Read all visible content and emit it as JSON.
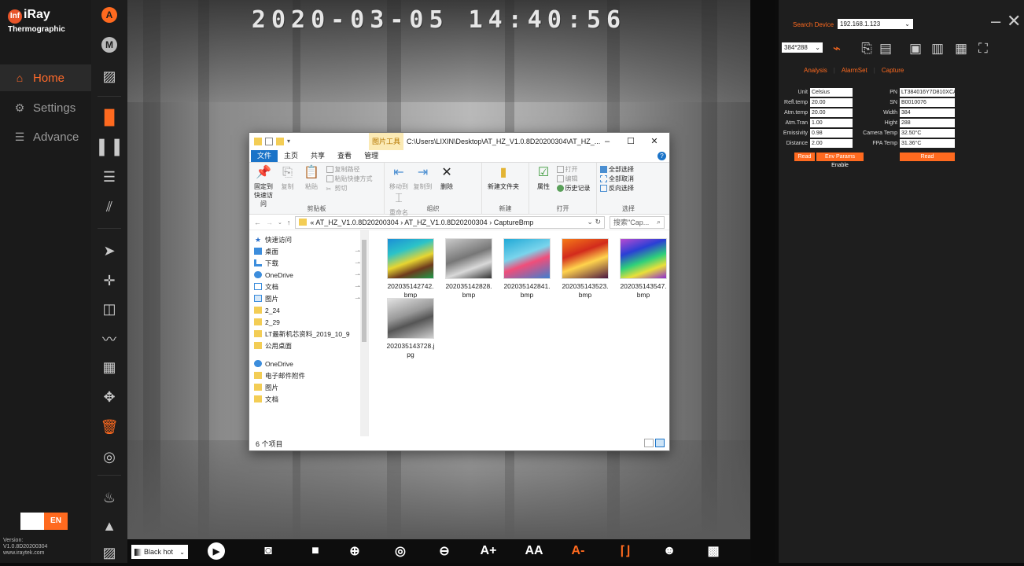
{
  "app": {
    "brand": "iRay",
    "brand_badge": "Inf",
    "subtitle": "Thermographic",
    "version_label": "Version:",
    "version": "V1.0.8D20200304",
    "website": "www.iraytek.com",
    "lang": "EN"
  },
  "nav": [
    {
      "label": "Home",
      "icon": "home-icon"
    },
    {
      "label": "Settings",
      "icon": "gear-icon"
    },
    {
      "label": "Advance",
      "icon": "sliders-icon"
    }
  ],
  "toolstrip": {
    "a_label": "A",
    "m_label": "M"
  },
  "timestamp": "2020-03-05 14:40:56",
  "bottombar": {
    "palette": "Black hot",
    "a_plus": "A+",
    "a_auto": "AA",
    "a_minus": "A-"
  },
  "explorer": {
    "picture_tools": "图片工具",
    "path": "C:\\Users\\LIXIN\\Desktop\\AT_HZ_V1.0.8D20200304\\AT_HZ_...",
    "tabs": [
      "文件",
      "主页",
      "共享",
      "查看",
      "管理"
    ],
    "ribbon": {
      "pin": "固定到快速访问",
      "copy": "复制",
      "paste": "粘贴",
      "copy_path": "复制路径",
      "paste_shortcut": "粘贴快捷方式",
      "cut": "剪切",
      "group_clipboard": "剪贴板",
      "move_to": "移动到",
      "copy_to": "复制到",
      "delete": "删除",
      "rename": "重命名",
      "group_organize": "组织",
      "new_folder": "新建文件夹",
      "group_new": "新建",
      "properties": "属性",
      "open": "打开",
      "edit": "编辑",
      "history": "历史记录",
      "group_open": "打开",
      "select_all": "全部选择",
      "select_none": "全部取消",
      "invert": "反向选择",
      "group_select": "选择"
    },
    "address": "« AT_HZ_V1.0.8D20200304 › AT_HZ_V1.0.8D20200304 › CaptureBmp",
    "search_placeholder": "搜索\"Cap...",
    "sidebar": [
      {
        "label": "快速访问",
        "type": "star",
        "pin": false
      },
      {
        "label": "桌面",
        "type": "desk",
        "pin": true
      },
      {
        "label": "下载",
        "type": "down",
        "pin": true
      },
      {
        "label": "OneDrive",
        "type": "cloud",
        "pin": true
      },
      {
        "label": "文档",
        "type": "doc",
        "pin": true
      },
      {
        "label": "图片",
        "type": "pic",
        "pin": true
      },
      {
        "label": "2_24",
        "type": "folder",
        "pin": false
      },
      {
        "label": "2_29",
        "type": "folder",
        "pin": false
      },
      {
        "label": "LT最新机芯资料_2019_10_9",
        "type": "folder",
        "pin": false
      },
      {
        "label": "公用桌面",
        "type": "folder",
        "pin": false
      },
      {
        "label": "",
        "type": "gap",
        "pin": false
      },
      {
        "label": "OneDrive",
        "type": "cloud",
        "pin": false
      },
      {
        "label": "电子邮件附件",
        "type": "folder",
        "pin": false
      },
      {
        "label": "图片",
        "type": "folder",
        "pin": false
      },
      {
        "label": "文档",
        "type": "folder",
        "pin": false
      }
    ],
    "files": [
      {
        "name1": "202035142742.",
        "name2": "bmp",
        "palette": "rainbow"
      },
      {
        "name1": "202035142828.",
        "name2": "bmp",
        "palette": "gray"
      },
      {
        "name1": "202035142841.",
        "name2": "bmp",
        "palette": "cool"
      },
      {
        "name1": "202035143523.",
        "name2": "bmp",
        "palette": "iron"
      },
      {
        "name1": "202035143547.",
        "name2": "bmp",
        "palette": "rainbow2"
      },
      {
        "name1": "202035143728.j",
        "name2": "pg",
        "palette": "gray2"
      }
    ],
    "status": "6 个项目"
  },
  "right": {
    "search_device_label": "Search Device",
    "ip": "192.168.1.123",
    "resolution": "384*288",
    "tabs": [
      "Analysis",
      "AlarmSet",
      "Capture"
    ],
    "params_left": [
      {
        "label": "Unit",
        "value": "Celsius"
      },
      {
        "label": "Refl.temp",
        "value": "20.00"
      },
      {
        "label": "Atm.temp",
        "value": "20.00"
      },
      {
        "label": "Atm.Tran",
        "value": "1.00"
      },
      {
        "label": "Emissivity",
        "value": "0.98"
      },
      {
        "label": "Distance",
        "value": "2.00"
      }
    ],
    "params_right": [
      {
        "label": "PN",
        "value": "LT384016Y7D810XCA)"
      },
      {
        "label": "SN",
        "value": "B0010076"
      },
      {
        "label": "Width",
        "value": "384"
      },
      {
        "label": "Hight",
        "value": "288"
      },
      {
        "label": "Camera Temp",
        "value": "32.50°C"
      },
      {
        "label": "FPA Temp",
        "value": "31.36°C"
      }
    ],
    "read_left": "Read",
    "env_btn": "Env Params Enable",
    "read_right": "Read"
  }
}
